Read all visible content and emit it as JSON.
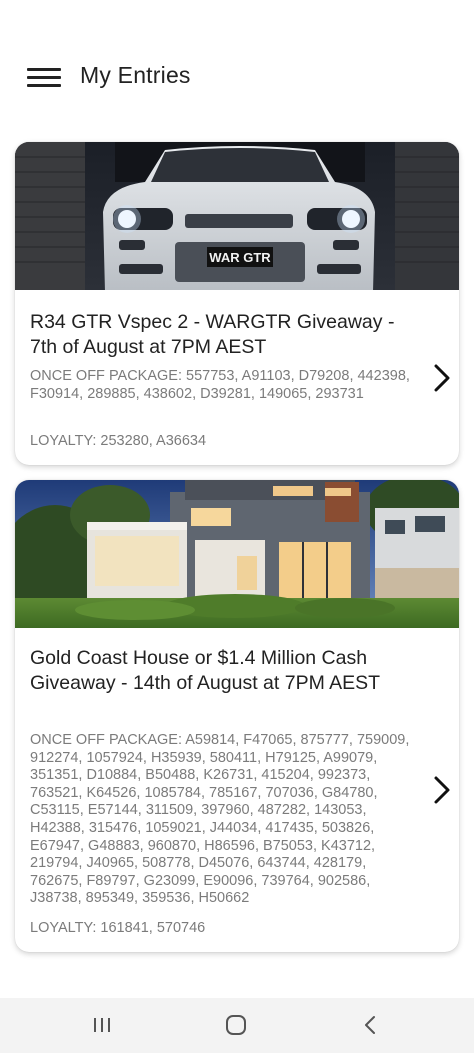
{
  "header": {
    "menu_icon": "hamburger-menu-icon",
    "title": "My Entries"
  },
  "entries": [
    {
      "image_plate_text": "WAR GTR",
      "title": "R34 GTR Vspec 2 - WARGTR Giveaway - 7th of August at 7PM AEST",
      "once_off_package": "ONCE OFF PACKAGE: 557753, A91103, D79208, 442398, F30914, 289885, 438602, D39281, 149065, 293731",
      "loyalty": "LOYALTY: 253280, A36634",
      "chevron_icon": "chevron-right-icon"
    },
    {
      "title": "Gold Coast House or $1.4 Million Cash Giveaway - 14th of August at 7PM AEST",
      "once_off_package": "ONCE OFF PACKAGE: A59814, F47065, 875777, 759009, 912274, 1057924, H35939, 580411, H79125, A99079, 351351, D10884, B50488, K26731, 415204, 992373, 763521, K64526, 1085784, 785167, 707036, G84780, C53115, E57144, 311509, 397960, 487282, 143053, H42388, 315476, 1059021, J44034, 417435, 503826, E67947, G48883, 960870, H86596, B75053, K43712, 219794, J40965, 508778, D45076, 643744, 428179, 762675, F89797, G23099, E90096, 739764, 902586, J38738, 895349, 359536, H50662",
      "loyalty": "LOYALTY: 161841, 570746",
      "chevron_icon": "chevron-right-icon"
    }
  ],
  "nav_bar": {
    "recent_icon": "recent-apps-icon",
    "home_icon": "home-icon",
    "back_icon": "back-icon"
  },
  "colors": {
    "text": "#222222",
    "muted_text": "#7b7b7b",
    "card_bg": "#ffffff",
    "nav_bg": "#f3f3f3"
  }
}
